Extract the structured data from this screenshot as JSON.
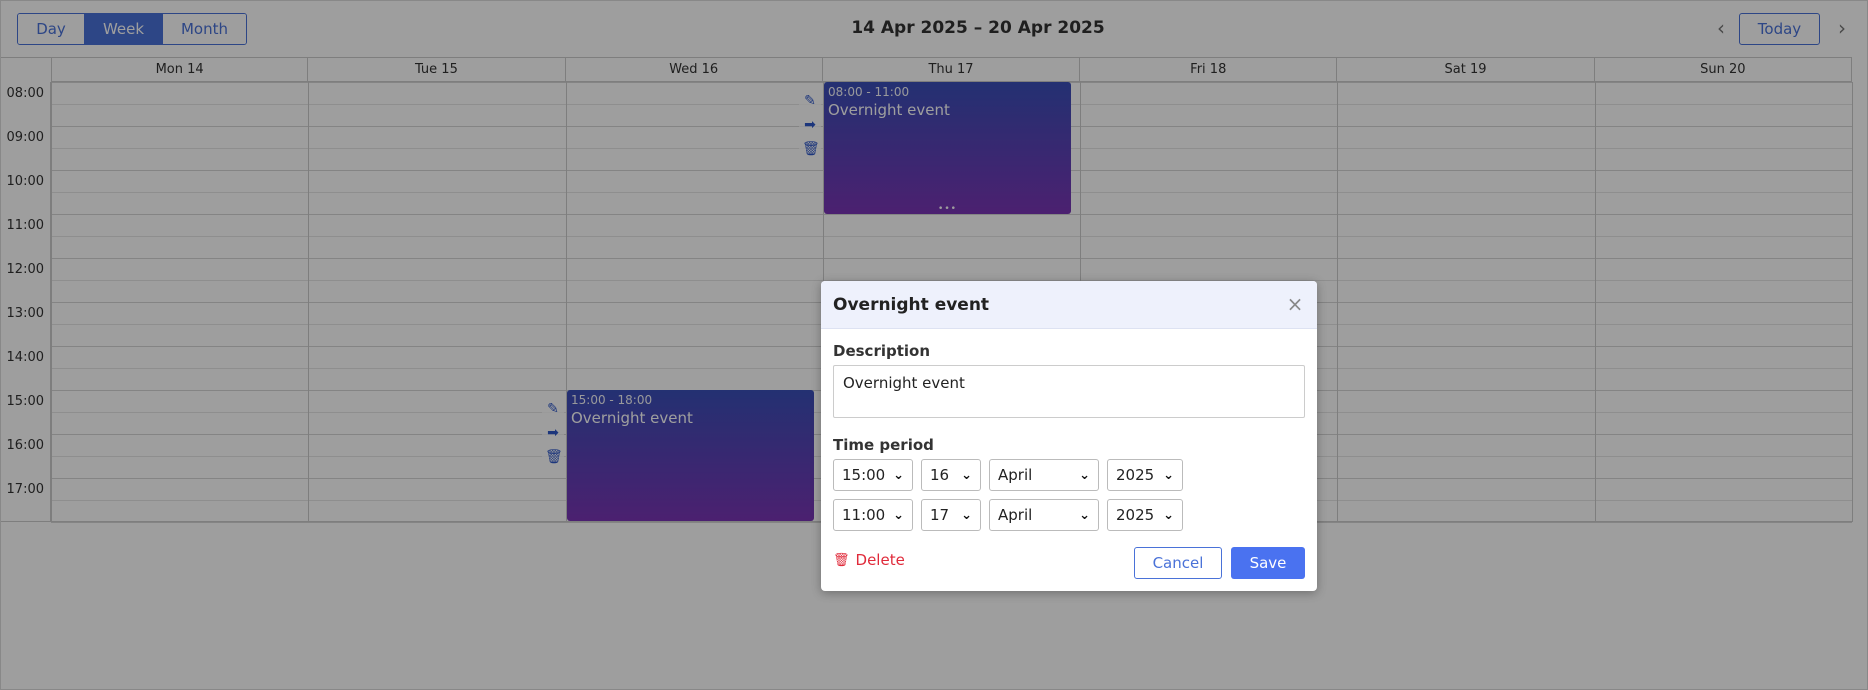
{
  "header": {
    "views": [
      {
        "label": "Day",
        "active": false
      },
      {
        "label": "Week",
        "active": true
      },
      {
        "label": "Month",
        "active": false
      }
    ],
    "date_range": "14 Apr 2025 – 20 Apr 2025",
    "prev_icon": "‹",
    "today_label": "Today",
    "next_icon": "›"
  },
  "days": [
    "Mon 14",
    "Tue 15",
    "Wed 16",
    "Thu 17",
    "Fri 18",
    "Sat 19",
    "Sun 20"
  ],
  "hours": [
    "08:00",
    "09:00",
    "10:00",
    "11:00",
    "12:00",
    "13:00",
    "14:00",
    "15:00",
    "16:00",
    "17:00"
  ],
  "events": [
    {
      "time": "08:00 - 11:00",
      "title": "Overnight event",
      "resize_handle": "•••"
    },
    {
      "time": "15:00 - 18:00",
      "title": "Overnight event"
    }
  ],
  "event_tools": {
    "edit_icon": "✎",
    "move_icon": "➡",
    "delete_icon": "🗑"
  },
  "modal": {
    "title": "Overnight event",
    "close_icon": "×",
    "description_label": "Description",
    "description_value": "Overnight event",
    "time_period_label": "Time period",
    "start": {
      "time": "15:00",
      "day": "16",
      "month": "April",
      "year": "2025"
    },
    "end": {
      "time": "11:00",
      "day": "17",
      "month": "April",
      "year": "2025"
    },
    "select_chevron": "⌄",
    "delete_label": "Delete",
    "delete_icon": "🗑",
    "cancel_label": "Cancel",
    "save_label": "Save"
  },
  "colors": {
    "accent": "#4a72d8",
    "event_top": "#3a4fb8",
    "event_bottom": "#7a35b5",
    "danger": "#e02a3a"
  }
}
